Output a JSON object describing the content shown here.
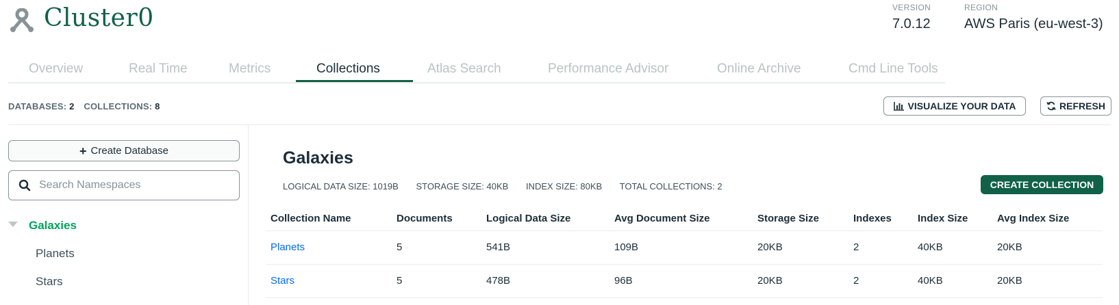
{
  "header": {
    "cluster_name": "Cluster0",
    "version_label": "VERSION",
    "version_value": "7.0.12",
    "region_label": "REGION",
    "region_value": "AWS Paris (eu-west-3)"
  },
  "tabs": [
    {
      "label": "Overview",
      "active": false
    },
    {
      "label": "Real Time",
      "active": false
    },
    {
      "label": "Metrics",
      "active": false
    },
    {
      "label": "Collections",
      "active": true
    },
    {
      "label": "Atlas Search",
      "active": false
    },
    {
      "label": "Performance Advisor",
      "active": false
    },
    {
      "label": "Online Archive",
      "active": false
    },
    {
      "label": "Cmd Line Tools",
      "active": false
    }
  ],
  "stats": {
    "databases_label": "DATABASES:",
    "databases_value": "2",
    "collections_label": "COLLECTIONS:",
    "collections_value": "8"
  },
  "toolbar": {
    "visualize_label": "VISUALIZE YOUR DATA",
    "refresh_label": "REFRESH"
  },
  "sidebar": {
    "create_db_label": "Create Database",
    "search_placeholder": "Search Namespaces",
    "database": {
      "name": "Galaxies",
      "collections": [
        "Planets",
        "Stars"
      ]
    }
  },
  "main": {
    "title": "Galaxies",
    "logical_size": "LOGICAL DATA SIZE: 1019B",
    "storage_size": "STORAGE SIZE: 40KB",
    "index_size": "INDEX SIZE: 80KB",
    "total_collections": "TOTAL COLLECTIONS: 2",
    "create_collection_label": "CREATE COLLECTION",
    "table": {
      "headers": [
        "Collection Name",
        "Documents",
        "Logical Data Size",
        "Avg Document Size",
        "Storage Size",
        "Indexes",
        "Index Size",
        "Avg Index Size"
      ],
      "rows": [
        [
          "Planets",
          "5",
          "541B",
          "109B",
          "20KB",
          "2",
          "40KB",
          "20KB"
        ],
        [
          "Stars",
          "5",
          "478B",
          "96B",
          "20KB",
          "2",
          "40KB",
          "20KB"
        ]
      ]
    }
  },
  "colors": {
    "brand_green": "#116149",
    "db_green": "#00a35c",
    "link_blue": "#016bf8"
  }
}
